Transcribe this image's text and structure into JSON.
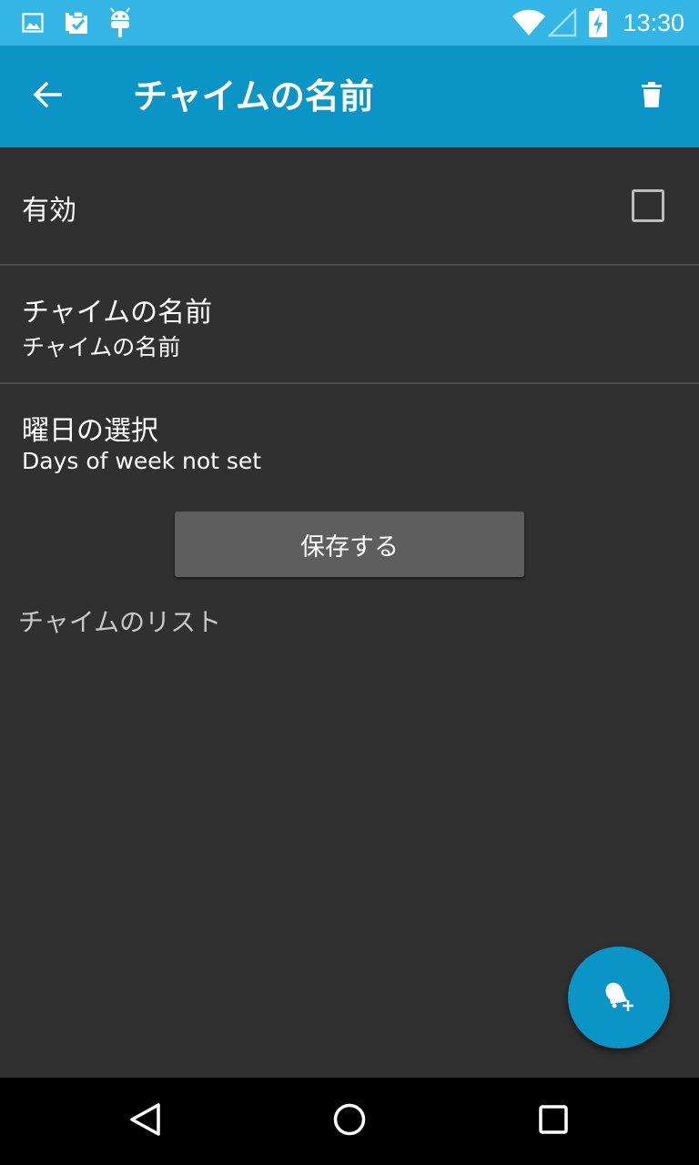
{
  "status_bar": {
    "time": "13:30",
    "icons": [
      "image-icon",
      "clipboard-check-icon",
      "android-icon",
      "wifi-icon",
      "signal-icon",
      "battery-charging-icon"
    ]
  },
  "app_bar": {
    "title": "チャイムの名前",
    "back_icon": "arrow-back-icon",
    "delete_icon": "trash-icon"
  },
  "preferences": {
    "enabled": {
      "title": "有効",
      "checked": false
    },
    "name": {
      "title": "チャイムの名前",
      "summary": "チャイムの名前"
    },
    "days": {
      "title": "曜日の選択",
      "summary": "Days of week not set"
    }
  },
  "save_button": {
    "label": "保存する"
  },
  "chime_list": {
    "header": "チャイムのリスト"
  },
  "fab": {
    "icon": "bell-add-icon"
  },
  "nav_bar": {
    "icons": [
      "back-triangle-icon",
      "home-circle-icon",
      "recents-square-icon"
    ]
  },
  "colors": {
    "status_bar": "#33b5e5",
    "app_bar": "#0b94c6",
    "background": "#303030",
    "button": "#5e5e5f",
    "accent": "#0b94c6"
  }
}
